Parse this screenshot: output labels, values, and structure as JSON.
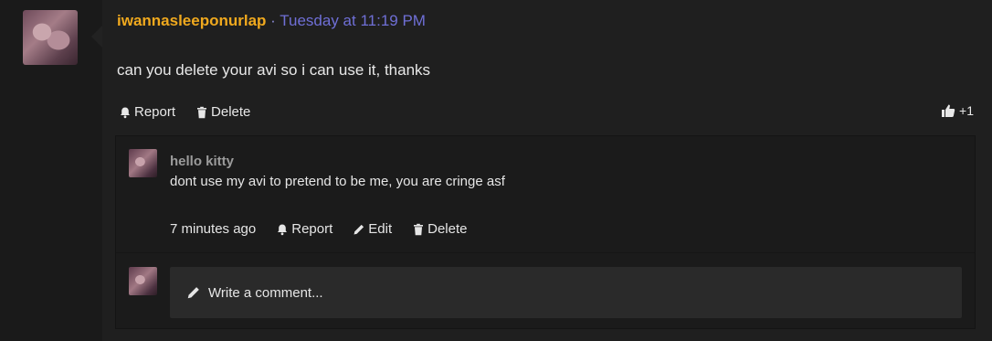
{
  "post": {
    "username": "iwannasleeponurlap",
    "separator": "·",
    "timestamp": "Tuesday at 11:19 PM",
    "message": "can you delete your avi so i can use it, thanks",
    "actions": {
      "report": "Report",
      "delete": "Delete"
    },
    "likes": "+1"
  },
  "comment": {
    "author": "hello kitty",
    "text": "dont use my avi to pretend to be me, you are cringe asf",
    "time": "7 minutes ago",
    "actions": {
      "report": "Report",
      "edit": "Edit",
      "delete": "Delete"
    }
  },
  "composer": {
    "placeholder": "Write a comment..."
  },
  "icons": {
    "report": "bell-icon",
    "delete": "trash-icon",
    "edit": "pencil-icon",
    "like": "thumbs-up-icon",
    "composer": "pencil-icon"
  },
  "colors": {
    "username": "#f0a91e",
    "timestamp": "#6f6fd6",
    "background": "#1a1a1a"
  }
}
